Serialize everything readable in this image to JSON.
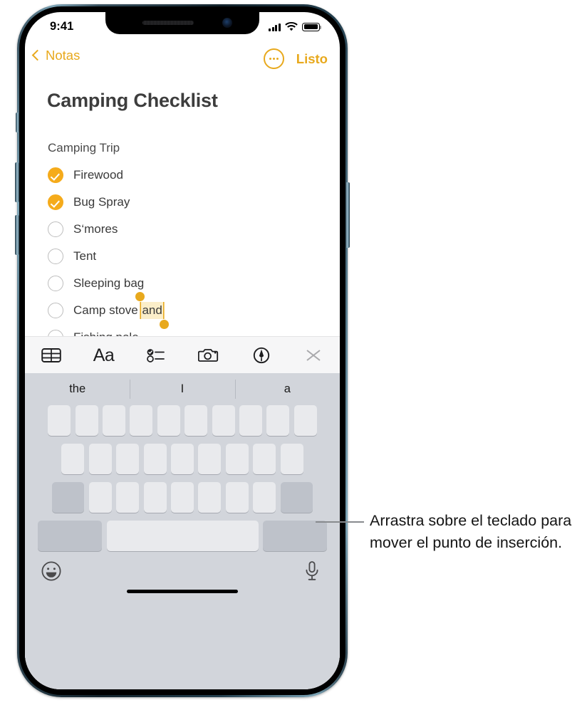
{
  "status_bar": {
    "time": "9:41",
    "signal_icon": "cellular-bars-icon",
    "wifi_icon": "wifi-icon",
    "battery_icon": "battery-full-icon"
  },
  "nav_bar": {
    "back_label": "Notas",
    "back_icon": "chevron-left-icon",
    "more_icon": "more-ellipsis-circle-icon",
    "done_label": "Listo"
  },
  "note": {
    "title": "Camping Checklist",
    "subtitle": "Camping Trip",
    "items": [
      {
        "label": "Firewood",
        "checked": true
      },
      {
        "label": "Bug Spray",
        "checked": true
      },
      {
        "label": "S‘mores",
        "checked": false
      },
      {
        "label": "Tent",
        "checked": false
      },
      {
        "label": "Sleeping bag",
        "checked": false
      },
      {
        "label": "Camp stove ",
        "checked": false,
        "selected_text": "and"
      },
      {
        "label": "Fishing pole",
        "checked": false
      }
    ],
    "selection": {
      "selected_text": "and",
      "highlight_color": "#fbeec9",
      "handle_color": "#e8a91d"
    }
  },
  "format_toolbar": {
    "items": [
      {
        "name": "table-icon",
        "label": "Tabla"
      },
      {
        "name": "text-format-icon",
        "label": "Aa"
      },
      {
        "name": "checklist-icon",
        "label": "Lista de verificación"
      },
      {
        "name": "camera-icon",
        "label": "Cámara"
      },
      {
        "name": "markup-pen-icon",
        "label": "Marcado"
      },
      {
        "name": "close-icon",
        "label": "Cerrar"
      }
    ],
    "aa_label": "Aa"
  },
  "keyboard": {
    "predictions": [
      "the",
      "I",
      "a"
    ],
    "rows": [
      {
        "name": "row-1",
        "keys": [
          "",
          "",
          "",
          "",
          "",
          "",
          "",
          "",
          "",
          ""
        ]
      },
      {
        "name": "row-2",
        "keys": [
          "",
          "",
          "",
          "",
          "",
          "",
          "",
          "",
          ""
        ]
      },
      {
        "name": "row-3",
        "keys": [
          "",
          "",
          "",
          "",
          "",
          "",
          "",
          "",
          ""
        ]
      },
      {
        "name": "row-4",
        "keys": [
          "",
          "",
          ""
        ]
      }
    ],
    "emoji_icon": "emoji-smiley-icon",
    "mic_icon": "microphone-icon",
    "home_indicator": "home-indicator"
  },
  "callout": {
    "text": "Arrastra sobre el teclado para mover el punto de inserción."
  },
  "colors": {
    "accent": "#e8a91d",
    "checkbox_on": "#f5ab1b",
    "keyboard_bg": "#d2d5db",
    "key_bg": "#e9eaed",
    "key_dark_bg": "#bec2ca",
    "toolbar_bg": "#f6f6f7"
  }
}
